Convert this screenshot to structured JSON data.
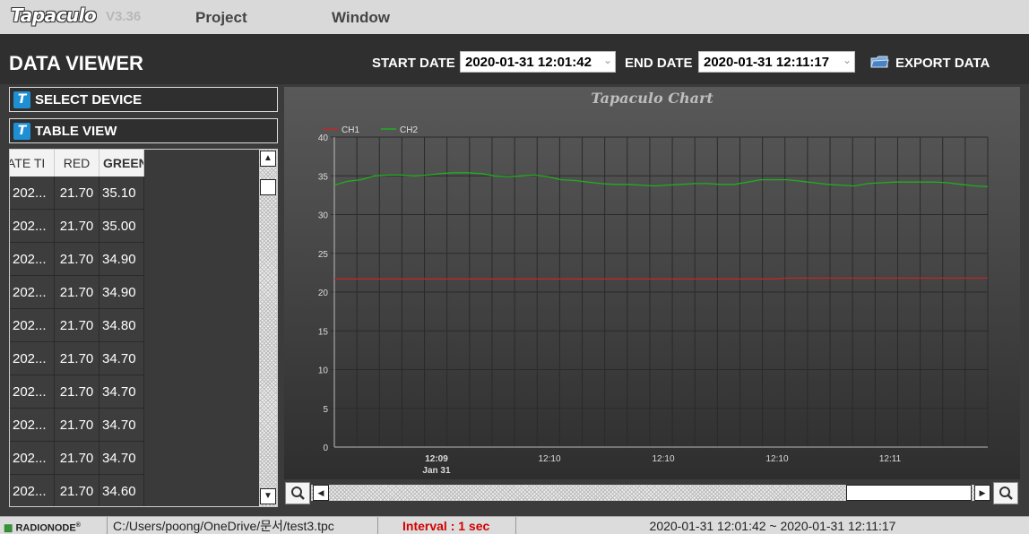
{
  "app": {
    "logo": "Tapaculo",
    "version": "V3.36"
  },
  "menu": {
    "items": [
      "Project",
      "Window"
    ]
  },
  "header": {
    "title": "DATA VIEWER",
    "start_label": "START DATE",
    "start_value": "2020-01-31 12:01:42",
    "end_label": "END DATE",
    "end_value": "2020-01-31 12:11:17",
    "export_label": "EXPORT DATA"
  },
  "sidebar": {
    "select_device": "SELECT DEVICE",
    "table_view": "TABLE VIEW",
    "icon_letter": "T"
  },
  "table": {
    "columns": [
      "ATE TI",
      "RED",
      "GREEN"
    ],
    "rows": [
      [
        "202...",
        "21.70",
        "35.10"
      ],
      [
        "202...",
        "21.70",
        "35.00"
      ],
      [
        "202...",
        "21.70",
        "34.90"
      ],
      [
        "202...",
        "21.70",
        "34.90"
      ],
      [
        "202...",
        "21.70",
        "34.80"
      ],
      [
        "202...",
        "21.70",
        "34.70"
      ],
      [
        "202...",
        "21.70",
        "34.70"
      ],
      [
        "202...",
        "21.70",
        "34.70"
      ],
      [
        "202...",
        "21.70",
        "34.70"
      ],
      [
        "202...",
        "21.70",
        "34.60"
      ]
    ]
  },
  "colors": {
    "ch1": "#c0262b",
    "ch2": "#1fae1f",
    "accent": "#1f8fd4",
    "interval": "#d40000"
  },
  "chart_data": {
    "type": "line",
    "title": "Tapaculo Chart",
    "xlabel": "",
    "ylabel": "",
    "ylim": [
      0,
      40
    ],
    "yticks": [
      0,
      5,
      10,
      15,
      20,
      25,
      30,
      35,
      40
    ],
    "xticks": [
      {
        "label": "12:09",
        "sub": "Jan 31",
        "bold": true
      },
      {
        "label": "12:10",
        "sub": "",
        "bold": false
      },
      {
        "label": "12:10",
        "sub": "",
        "bold": false
      },
      {
        "label": "12:10",
        "sub": "",
        "bold": false
      },
      {
        "label": "12:11",
        "sub": "",
        "bold": false
      }
    ],
    "grid": true,
    "legend_position": "top-left",
    "series": [
      {
        "name": "CH1",
        "values": [
          21.7,
          21.7,
          21.7,
          21.7,
          21.7,
          21.7,
          21.7,
          21.7,
          21.7,
          21.7,
          21.7,
          21.7,
          21.7,
          21.7,
          21.7,
          21.7,
          21.7,
          21.7,
          21.7,
          21.7,
          21.7,
          21.7,
          21.7,
          21.7,
          21.7,
          21.7,
          21.7,
          21.7,
          21.7,
          21.7,
          21.7,
          21.7,
          21.7,
          21.7,
          21.8,
          21.8,
          21.8,
          21.8,
          21.8,
          21.8,
          21.8,
          21.8,
          21.8,
          21.8,
          21.8,
          21.8,
          21.8,
          21.8,
          21.8,
          21.8
        ]
      },
      {
        "name": "CH2",
        "values": [
          33.8,
          34.3,
          34.5,
          35.0,
          35.1,
          35.1,
          35.0,
          35.1,
          35.3,
          35.4,
          35.4,
          35.3,
          35.0,
          34.9,
          35.0,
          35.1,
          34.9,
          34.5,
          34.4,
          34.2,
          34.0,
          33.9,
          33.9,
          33.8,
          33.7,
          33.8,
          33.9,
          34.0,
          34.0,
          33.9,
          33.9,
          34.2,
          34.5,
          34.5,
          34.5,
          34.3,
          34.1,
          33.9,
          33.8,
          33.7,
          34.0,
          34.1,
          34.2,
          34.2,
          34.2,
          34.2,
          34.1,
          33.9,
          33.7,
          33.6
        ]
      }
    ]
  },
  "status": {
    "brand": "RADIONODE",
    "path": "C:/Users/poong/OneDrive/문서/test3.tpc",
    "interval": "Interval : 1 sec",
    "range": "2020-01-31 12:01:42 ~ 2020-01-31 12:11:17"
  }
}
